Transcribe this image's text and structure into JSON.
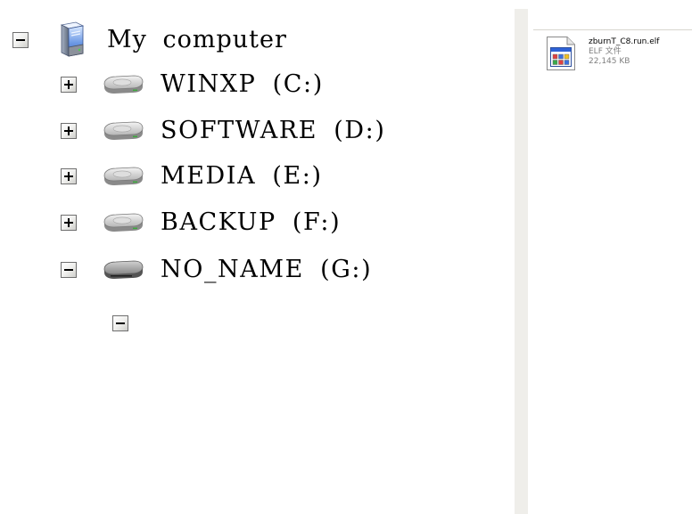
{
  "tree": {
    "root": {
      "label": "My computer",
      "icon": "computer-icon",
      "expander_icon": "minus-box-icon"
    },
    "drives": [
      {
        "label": "WINXP (C:)",
        "icon": "hard-disk-icon",
        "expander_icon": "plus-box-icon"
      },
      {
        "label": "SOFTWARE (D:)",
        "icon": "hard-disk-icon",
        "expander_icon": "plus-box-icon"
      },
      {
        "label": "MEDIA (E:)",
        "icon": "hard-disk-icon",
        "expander_icon": "plus-box-icon"
      },
      {
        "label": "BACKUP (F:)",
        "icon": "hard-disk-icon",
        "expander_icon": "plus-box-icon"
      },
      {
        "label": "NO_NAME (G:)",
        "icon": "removable-disk-icon",
        "expander_icon": "minus-box-icon"
      }
    ],
    "subnode": {
      "expander_icon": "minus-box-icon"
    }
  },
  "file_list": {
    "items": [
      {
        "name": "zburnT_C8.run.elf",
        "type": "ELF 文件",
        "size": "22,145 KB",
        "icon": "elf-file-icon"
      }
    ]
  },
  "colors": {
    "background": "#ffffff",
    "splitter": "#efeeea",
    "secondary_text": "#808080",
    "expander_border": "#6f6f6f"
  }
}
